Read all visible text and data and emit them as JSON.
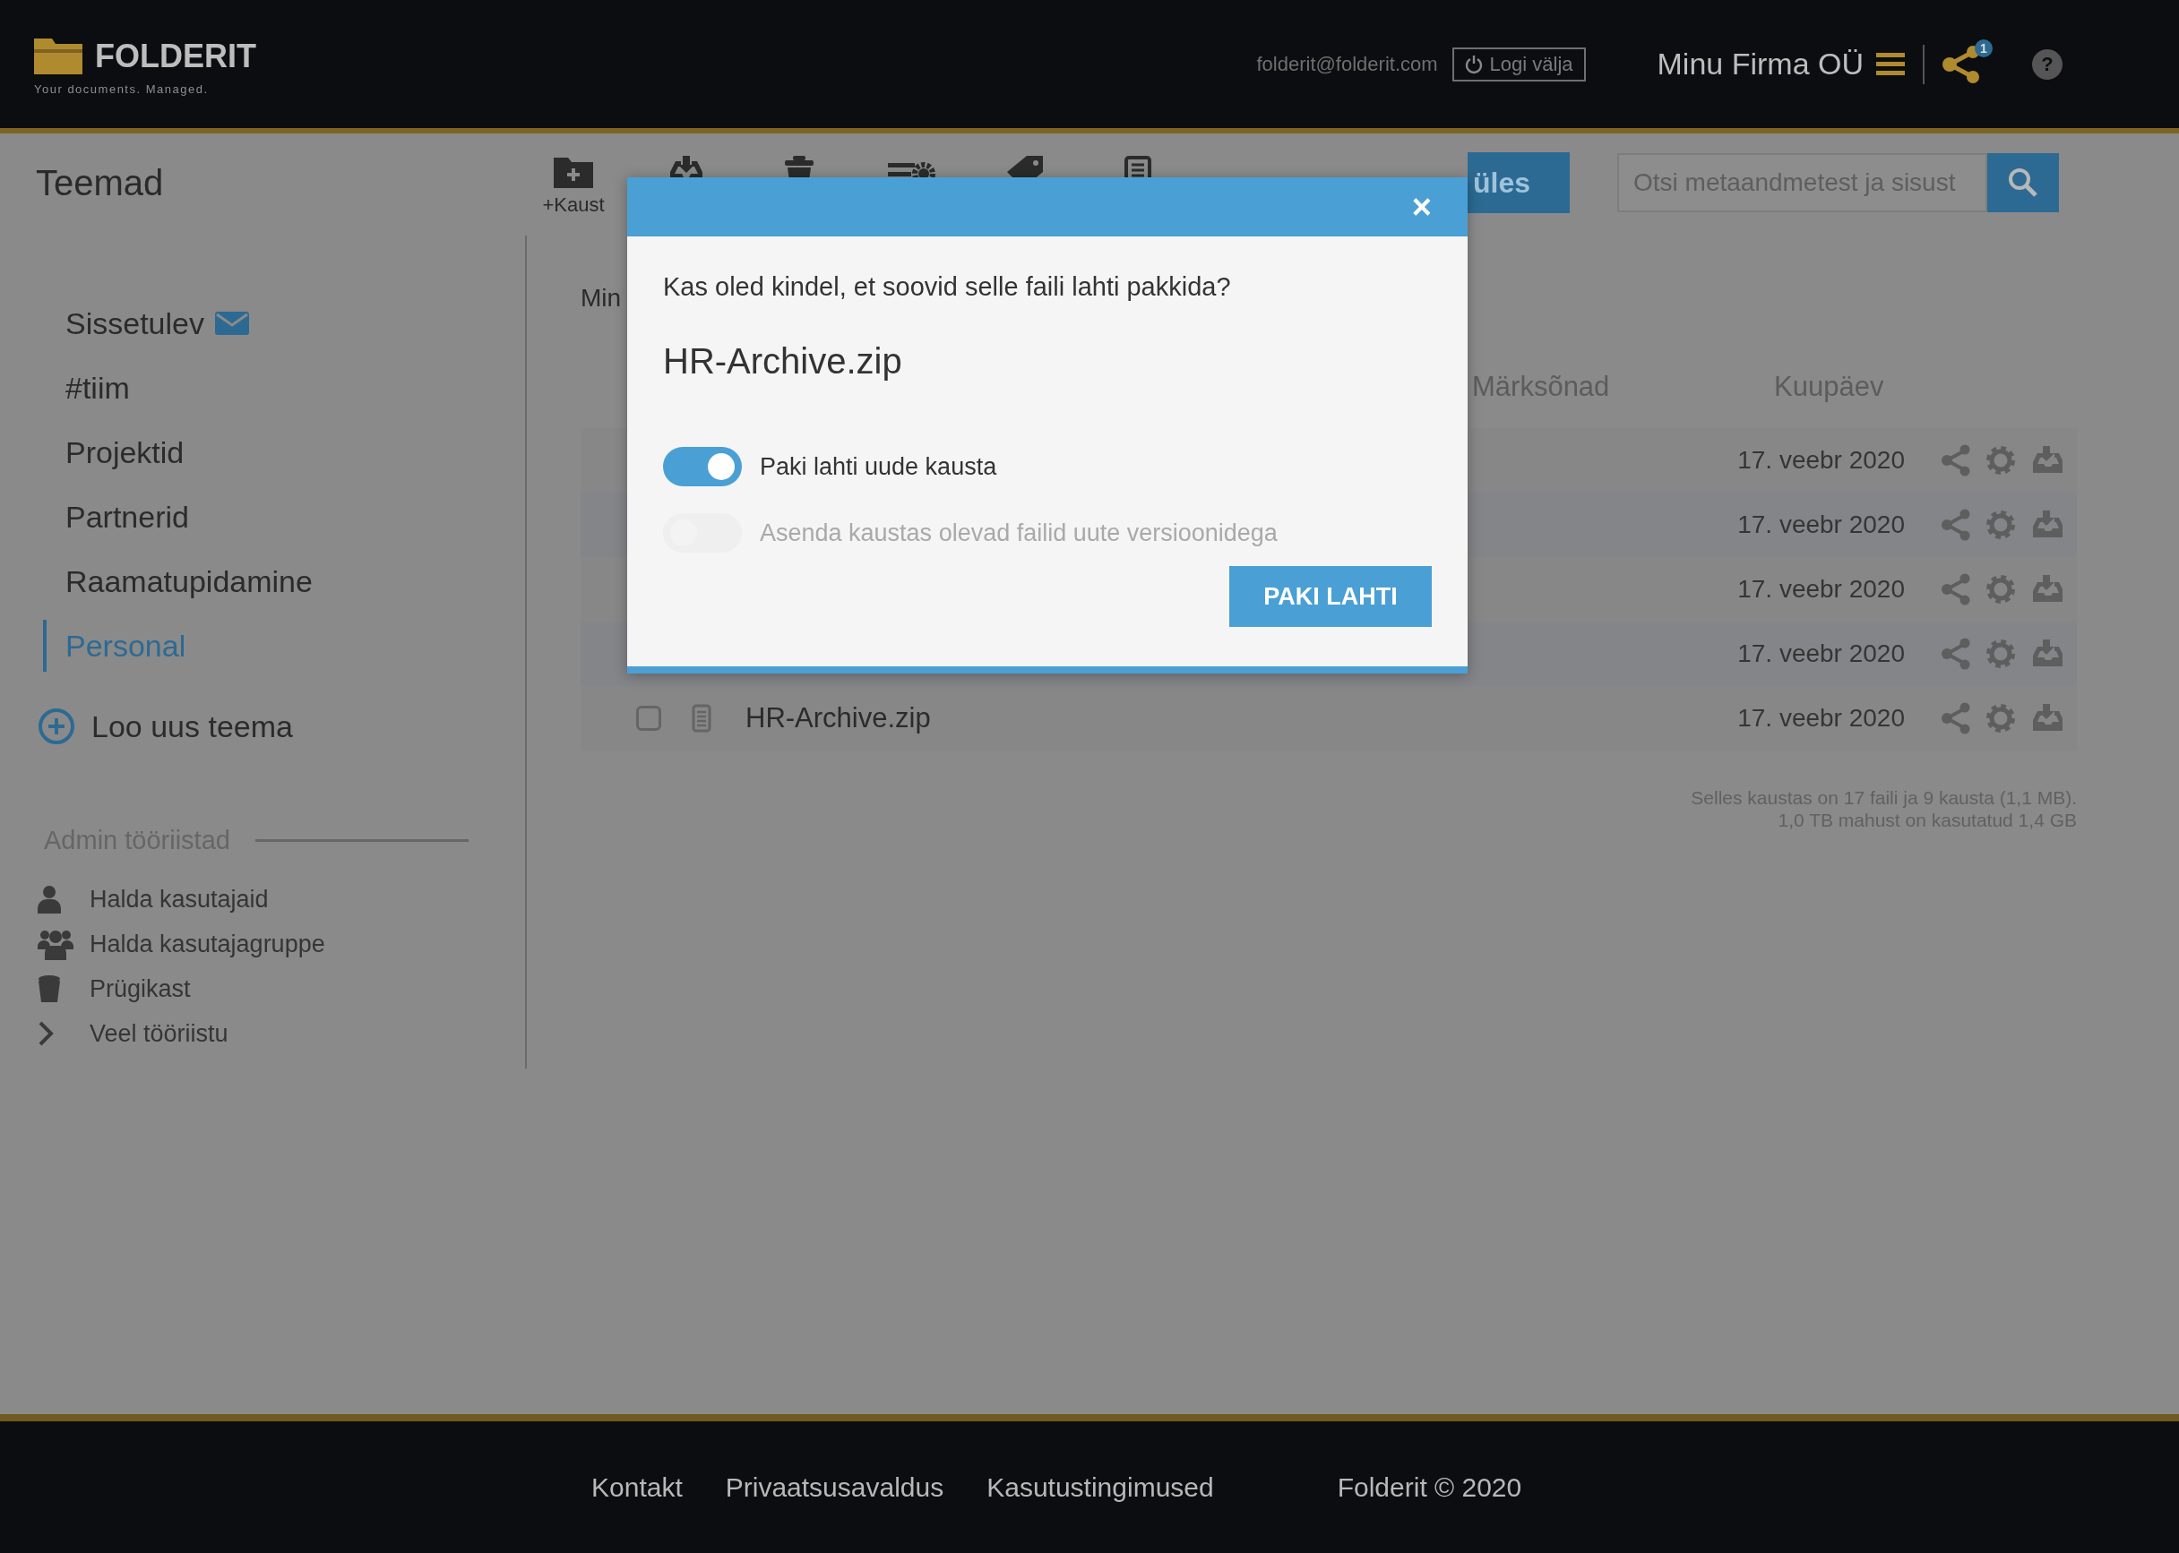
{
  "header": {
    "logo": {
      "name": "FOLDERIT",
      "tagline": "Your documents. Managed."
    },
    "email": "folderit@folderit.com",
    "logout": "Logi välja",
    "company": "Minu Firma OÜ",
    "share_badge": "1",
    "help": "?"
  },
  "toolbar": {
    "title": "Teemad",
    "actions": [
      {
        "kind": "new-folder",
        "label": "+Kaust"
      },
      {
        "kind": "download"
      },
      {
        "kind": "trash"
      },
      {
        "kind": "settings"
      },
      {
        "kind": "tag"
      },
      {
        "kind": "document"
      }
    ],
    "upload_button": "üles",
    "search": {
      "placeholder": "Otsi metaandmetest ja sisust"
    }
  },
  "sidebar": {
    "topics": [
      {
        "label": "Sissetulev",
        "mail": true,
        "selected": false
      },
      {
        "label": "#tiim",
        "mail": false,
        "selected": false
      },
      {
        "label": "Projektid",
        "mail": false,
        "selected": false
      },
      {
        "label": "Partnerid",
        "mail": false,
        "selected": false
      },
      {
        "label": "Raamatupidamine",
        "mail": false,
        "selected": false
      },
      {
        "label": "Personal",
        "mail": false,
        "selected": true
      }
    ],
    "new_topic": "Loo uus teema",
    "admin": {
      "title": "Admin tööriistad",
      "tools": [
        {
          "kind": "user",
          "label": "Halda kasutajaid"
        },
        {
          "kind": "group",
          "label": "Halda kasutajagruppe"
        },
        {
          "kind": "trash",
          "label": "Prügikast"
        },
        {
          "kind": "more",
          "label": "Veel tööriistu"
        }
      ]
    }
  },
  "content": {
    "breadcrumb": "Min",
    "columns": [
      "Märksõnad",
      "Kuupäev"
    ],
    "rows": [
      {
        "date": "17. veebr 2020"
      },
      {
        "date": "17. veebr 2020"
      },
      {
        "date": "17. veebr 2020"
      },
      {
        "date": "17. veebr 2020"
      },
      {
        "name": "HR-Archive.zip",
        "checked": false,
        "date": "17. veebr 2020"
      }
    ],
    "summary": [
      "Selles kaustas on 17 faili ja 9 kausta (1,1 MB).",
      "1,0 TB mahust on kasutatud 1,4 GB"
    ]
  },
  "modal": {
    "question": "Kas oled kindel, et soovid selle faili lahti pakkida?",
    "filename": "HR-Archive.zip",
    "options": [
      {
        "label": "Paki lahti uude kausta",
        "on": true,
        "disabled": false
      },
      {
        "label": "Asenda kaustas olevad failid uute versioonidega",
        "on": false,
        "disabled": true
      }
    ],
    "button": "PAKI LAHTI",
    "close": "×"
  },
  "footer": {
    "links": [
      "Kontakt",
      "Privaatsusavaldus",
      "Kasutustingimused"
    ],
    "copyright": "Folderit © 2020"
  }
}
